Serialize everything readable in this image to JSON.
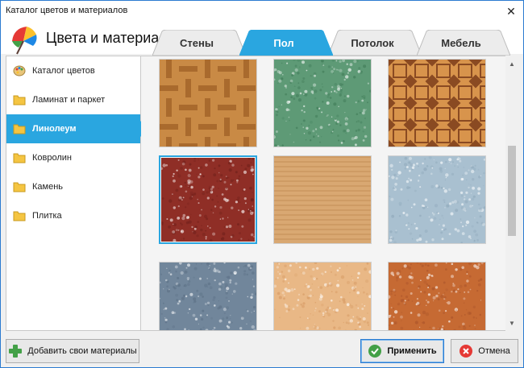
{
  "window": {
    "title": "Каталог цветов и материалов",
    "close_glyph": "✕"
  },
  "header": {
    "title": "Цвета и материалы",
    "logo_icon": "umbrella-icon"
  },
  "tabs": [
    {
      "label": "Стены",
      "active": false
    },
    {
      "label": "Пол",
      "active": true
    },
    {
      "label": "Потолок",
      "active": false
    },
    {
      "label": "Мебель",
      "active": false
    }
  ],
  "sidebar": {
    "items": [
      {
        "label": "Каталог цветов",
        "icon": "palette-icon",
        "active": false
      },
      {
        "label": "Ламинат и паркет",
        "icon": "folder-icon",
        "active": false
      },
      {
        "label": "Линолеум",
        "icon": "folder-icon",
        "active": true
      },
      {
        "label": "Ковролин",
        "icon": "folder-icon",
        "active": false
      },
      {
        "label": "Камень",
        "icon": "folder-icon",
        "active": false
      },
      {
        "label": "Плитка",
        "icon": "folder-icon",
        "active": false
      }
    ]
  },
  "materials": [
    {
      "name": "parquet-herringbone-texture",
      "colors": [
        "#c98a45",
        "#a96a2d"
      ],
      "selected": false
    },
    {
      "name": "green-granite-texture",
      "colors": [
        "#5e9a76",
        "#3f7a57"
      ],
      "selected": false
    },
    {
      "name": "octagon-pattern-texture",
      "colors": [
        "#d8944c",
        "#8a4a22"
      ],
      "selected": false
    },
    {
      "name": "red-speckled-texture",
      "colors": [
        "#8f2e26",
        "#6e1f1a"
      ],
      "selected": true
    },
    {
      "name": "light-wood-plank-texture",
      "colors": [
        "#d9a872",
        "#c38d56"
      ],
      "selected": false
    },
    {
      "name": "light-blue-marble-texture",
      "colors": [
        "#a9c0d0",
        "#8fa8ba"
      ],
      "selected": false
    },
    {
      "name": "grey-blue-marble-texture",
      "colors": [
        "#71869b",
        "#5b6f84"
      ],
      "selected": false
    },
    {
      "name": "beige-marble-texture",
      "colors": [
        "#e9b886",
        "#d69a64"
      ],
      "selected": false
    },
    {
      "name": "terracotta-marble-texture",
      "colors": [
        "#c66a33",
        "#a9532a"
      ],
      "selected": false
    }
  ],
  "buttons": {
    "add_materials": "Добавить свои материалы",
    "apply": "Применить",
    "cancel": "Отмена"
  },
  "colors": {
    "accent": "#2aa6e0",
    "tab_inactive": "#ececec"
  }
}
